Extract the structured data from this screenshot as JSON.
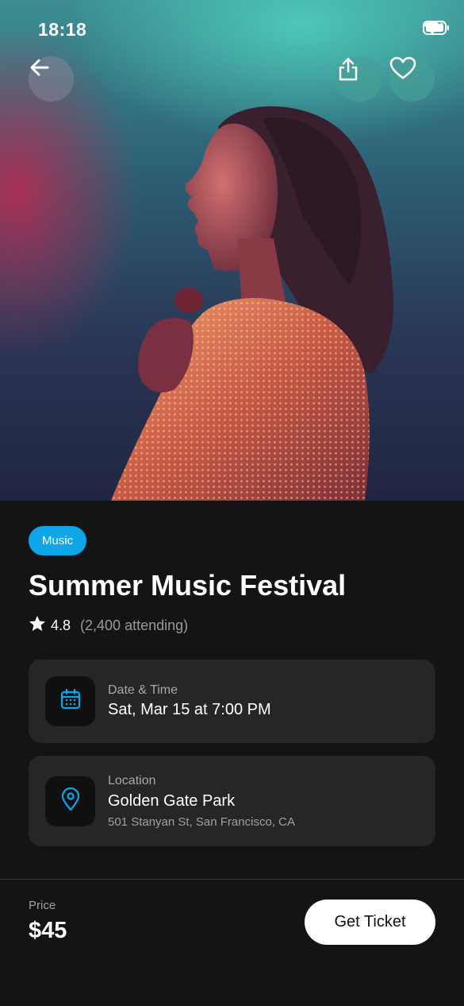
{
  "status_bar": {
    "time": "18:18",
    "icons": [
      "signal-icon",
      "wifi-icon",
      "battery-icon"
    ]
  },
  "header": {
    "back_icon": "arrow-left-icon",
    "share_icon": "share-icon",
    "favorite_icon": "heart-icon"
  },
  "event": {
    "category": "Music",
    "title": "Summer Music Festival",
    "rating": "4.8",
    "attending": "(2,400 attending)",
    "date_label": "Date & Time",
    "date_value": "Sat, Mar 15 at 7:00 PM",
    "location_label": "Location",
    "location_name": "Golden Gate Park",
    "location_address": "501 Stanyan St, San Francisco, CA"
  },
  "footer": {
    "price_label": "Price",
    "price_value": "$45",
    "cta_label": "Get Ticket"
  },
  "colors": {
    "accent": "#0ea5e9",
    "background": "#141414",
    "card": "#262626"
  }
}
